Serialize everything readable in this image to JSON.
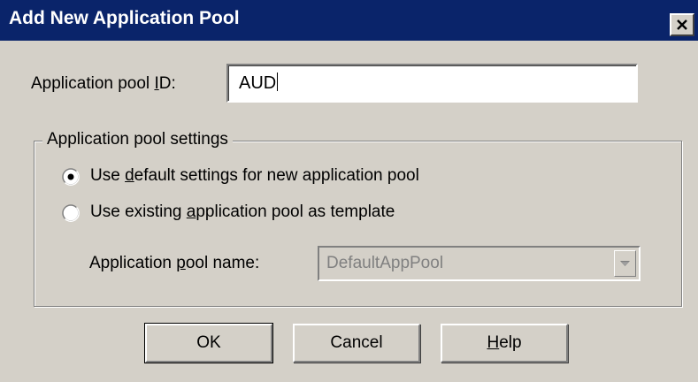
{
  "dialog": {
    "title": "Add New Application Pool",
    "close_icon": "close-icon"
  },
  "pool_id": {
    "label_pre": "Application pool ",
    "label_ul": "I",
    "label_post": "D:",
    "value": "AUD"
  },
  "settings_group": {
    "title": "Application pool settings",
    "options": [
      {
        "pre": "Use ",
        "ul": "d",
        "post": "efault settings for new application pool",
        "selected": true
      },
      {
        "pre": "Use existing ",
        "ul": "a",
        "post": "pplication pool as template",
        "selected": false
      }
    ],
    "pool_name": {
      "label_pre": "Application ",
      "label_ul": "p",
      "label_post": "ool name:",
      "value": "DefaultAppPool",
      "enabled": false
    }
  },
  "buttons": {
    "ok": "OK",
    "cancel": "Cancel",
    "help_ul": "H",
    "help_post": "elp"
  },
  "colors": {
    "titlebar": "#0a246a",
    "face": "#d4d0c8"
  }
}
